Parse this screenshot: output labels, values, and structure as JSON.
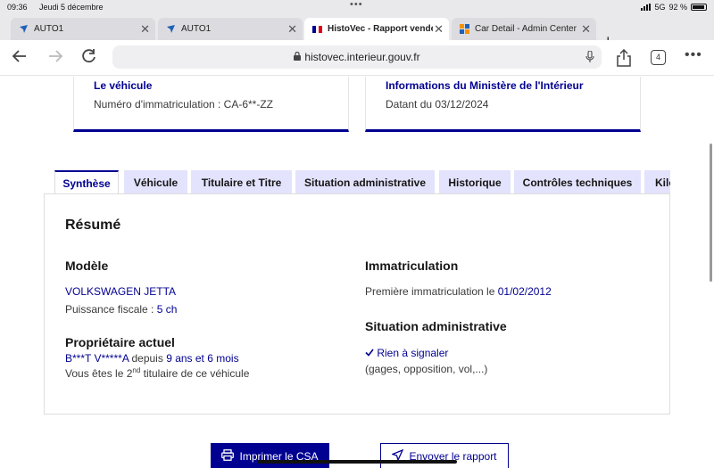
{
  "status_bar": {
    "time": "09:36",
    "date": "Jeudi 5 décembre",
    "network": "5G",
    "battery": "92 %"
  },
  "browser": {
    "tabs": [
      {
        "label": "AUTO1",
        "icon": "auto1-favicon"
      },
      {
        "label": "AUTO1",
        "icon": "auto1-favicon"
      },
      {
        "label": "HistoVec - Rapport vendeur",
        "icon": "french-flag-favicon"
      },
      {
        "label": "Car Detail - Admin Center",
        "icon": "admin-favicon"
      }
    ],
    "url": "histovec.interieur.gouv.fr",
    "tab_count": "4"
  },
  "cards": {
    "vehicle": {
      "title": "Le véhicule",
      "value": "Numéro d'immatriculation : CA-6**-ZZ"
    },
    "ministry": {
      "title": "Informations du Ministère de l'Intérieur",
      "value": "Datant du 03/12/2024"
    }
  },
  "report_tabs": [
    "Synthèse",
    "Véhicule",
    "Titulaire et Titre",
    "Situation administrative",
    "Historique",
    "Contrôles techniques",
    "Kilo"
  ],
  "summary": {
    "heading": "Résumé",
    "model": {
      "heading": "Modèle",
      "name": "VOLKSWAGEN JETTA",
      "power_label": "Puissance fiscale : ",
      "power_value": "5 ch"
    },
    "owner": {
      "heading": "Propriétaire actuel",
      "name": "B***T V*****A",
      "since_label": " depuis ",
      "since_value": "9 ans et 6 mois",
      "rank_pre": "Vous êtes le 2",
      "rank_sup": "nd",
      "rank_post": " titulaire de ce véhicule"
    },
    "registration": {
      "heading": "Immatriculation",
      "label": "Première immatriculation le ",
      "date": "01/02/2012"
    },
    "admin": {
      "heading": "Situation administrative",
      "status": "Rien à signaler",
      "detail": "(gages, opposition, vol,...)"
    }
  },
  "actions": {
    "print": "Imprimer le CSA",
    "send": "Envoyer le rapport"
  },
  "colors": {
    "primary": "#000091",
    "tab_bg": "#e3e3fd"
  }
}
